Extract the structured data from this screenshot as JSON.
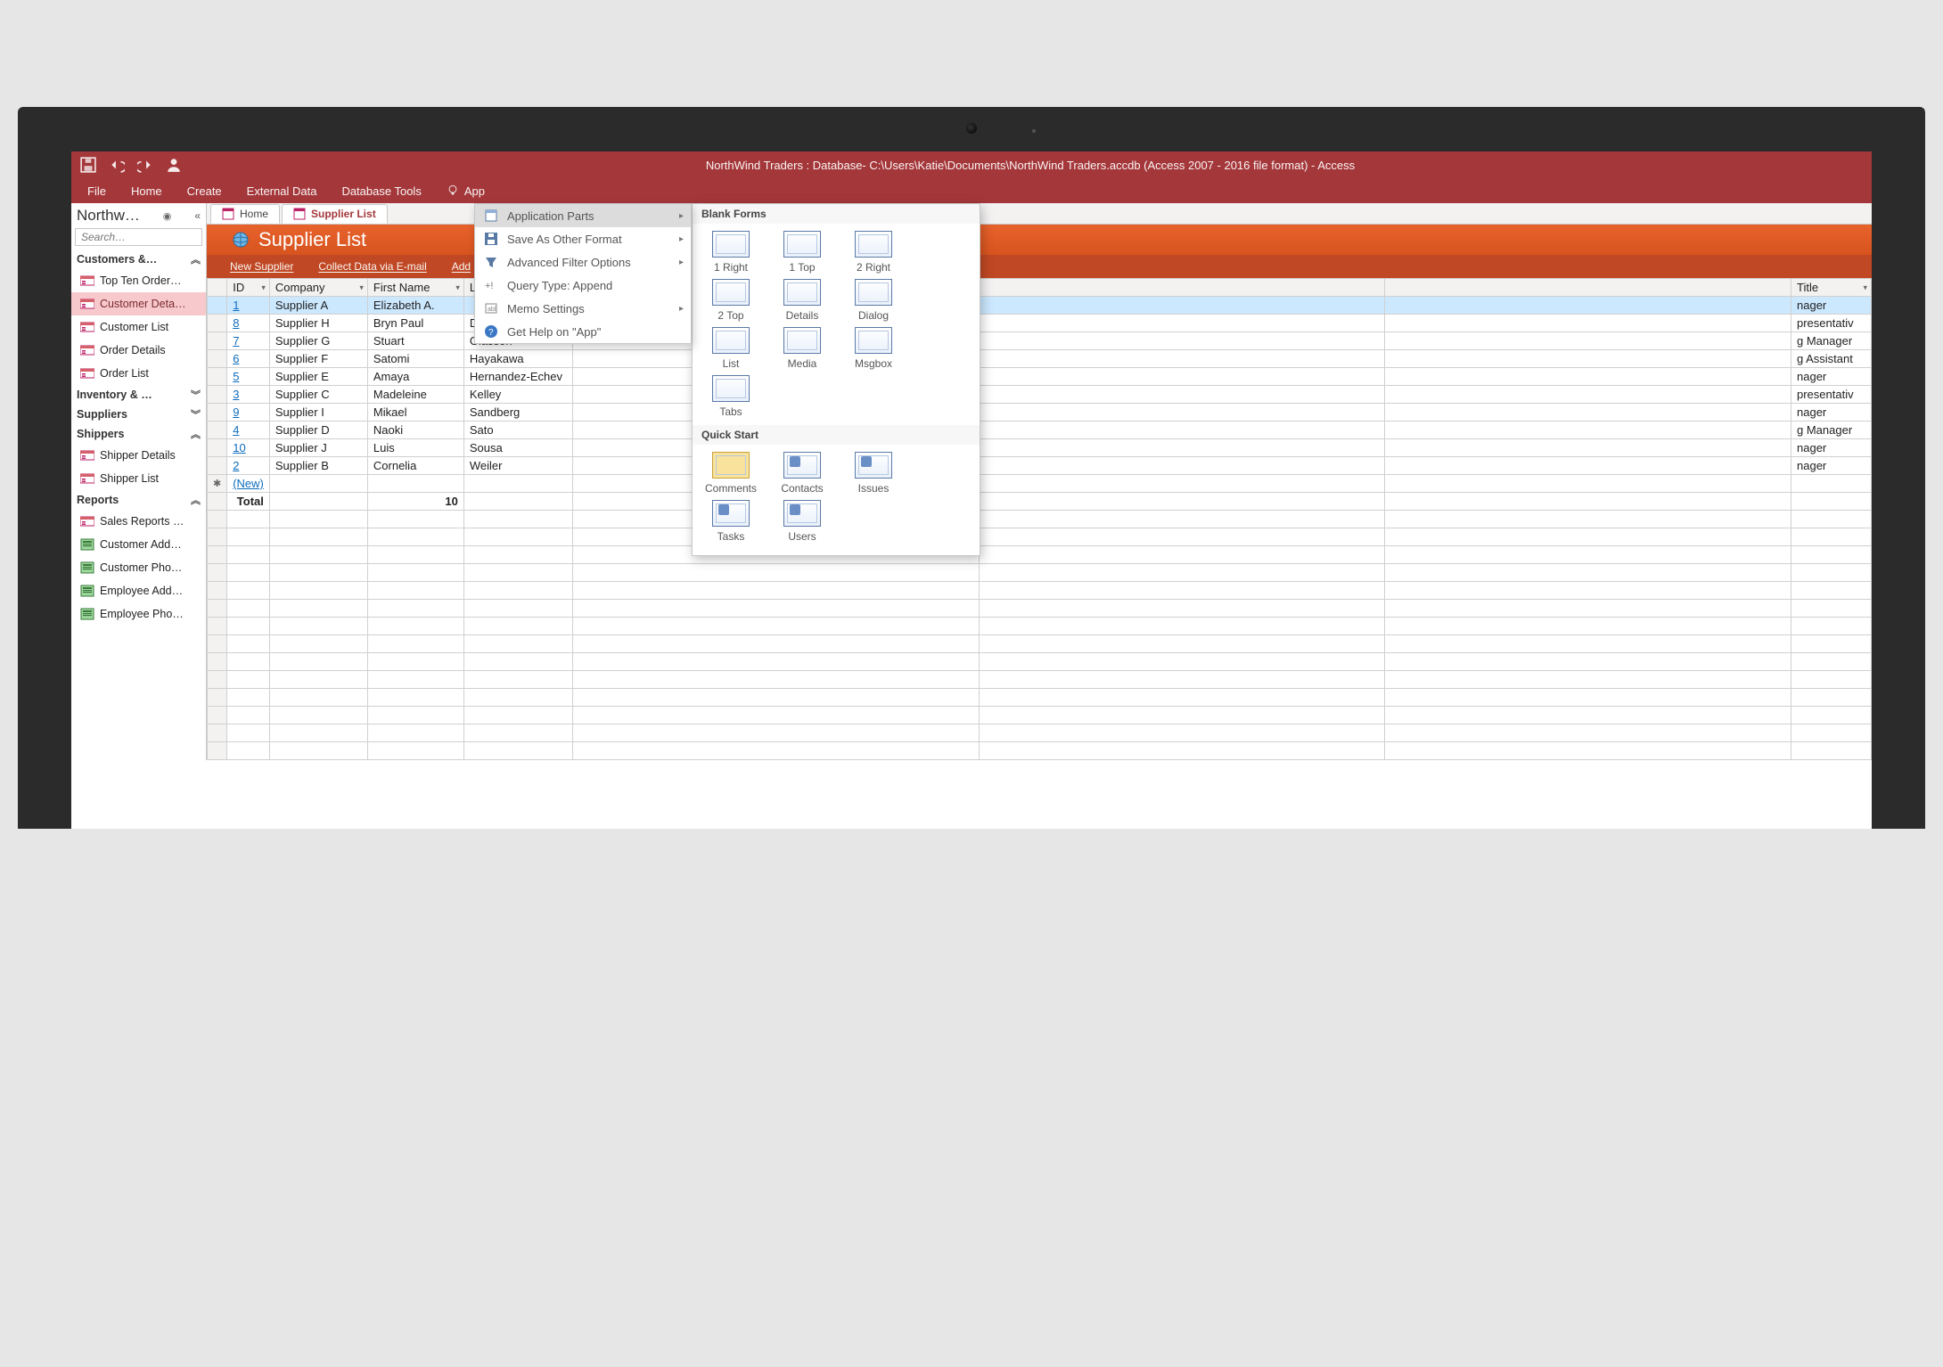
{
  "titlebar": {
    "title": "NorthWind Traders : Database- C:\\Users\\Katie\\Documents\\NorthWind Traders.accdb (Access 2007 - 2016 file format) - Access"
  },
  "ribbon": {
    "tabs": [
      "File",
      "Home",
      "Create",
      "External Data",
      "Database Tools"
    ],
    "app_tab": "App"
  },
  "navpane": {
    "title": "Northw…",
    "search_placeholder": "Search…",
    "groups": [
      {
        "label": "Customers &…",
        "expanded": true,
        "items": [
          {
            "label": "Top Ten Order…",
            "icon": "form"
          },
          {
            "label": "Customer Deta…",
            "icon": "form",
            "selected": true
          },
          {
            "label": "Customer List",
            "icon": "form"
          },
          {
            "label": "Order Details",
            "icon": "form"
          },
          {
            "label": "Order List",
            "icon": "form"
          }
        ]
      },
      {
        "label": "Inventory & …",
        "expanded": false,
        "items": []
      },
      {
        "label": "Suppliers",
        "expanded": false,
        "items": []
      },
      {
        "label": "Shippers",
        "expanded": true,
        "items": [
          {
            "label": "Shipper Details",
            "icon": "form"
          },
          {
            "label": "Shipper List",
            "icon": "form"
          }
        ]
      },
      {
        "label": "Reports",
        "expanded": true,
        "items": [
          {
            "label": "Sales Reports …",
            "icon": "form"
          },
          {
            "label": "Customer Add…",
            "icon": "report"
          },
          {
            "label": "Customer Pho…",
            "icon": "report"
          },
          {
            "label": "Employee Add…",
            "icon": "report"
          },
          {
            "label": "Employee Pho…",
            "icon": "report"
          }
        ]
      }
    ]
  },
  "doctabs": [
    {
      "label": "Home",
      "active": false
    },
    {
      "label": "Supplier List",
      "active": true
    }
  ],
  "form": {
    "title": "Supplier List",
    "toolbar": [
      "New Supplier",
      "Collect Data via E-mail",
      "Add"
    ]
  },
  "table": {
    "columns": [
      "",
      "ID",
      "Company",
      "First Name",
      "Last Name",
      "",
      "",
      "",
      "Title"
    ],
    "rows": [
      {
        "id": 1,
        "company": "Supplier A",
        "first": "Elizabeth A.",
        "last": "",
        "title": "nager",
        "selected": true
      },
      {
        "id": 8,
        "company": "Supplier H",
        "first": "Bryn Paul",
        "last": "Dunton",
        "title": "presentativ"
      },
      {
        "id": 7,
        "company": "Supplier G",
        "first": "Stuart",
        "last": "Glasson",
        "title": "g Manager"
      },
      {
        "id": 6,
        "company": "Supplier F",
        "first": "Satomi",
        "last": "Hayakawa",
        "title": "g Assistant"
      },
      {
        "id": 5,
        "company": "Supplier E",
        "first": "Amaya",
        "last": "Hernandez-Echev",
        "title": "nager"
      },
      {
        "id": 3,
        "company": "Supplier C",
        "first": "Madeleine",
        "last": "Kelley",
        "title": "presentativ"
      },
      {
        "id": 9,
        "company": "Supplier I",
        "first": "Mikael",
        "last": "Sandberg",
        "title": "nager"
      },
      {
        "id": 4,
        "company": "Supplier D",
        "first": "Naoki",
        "last": "Sato",
        "title": "g Manager"
      },
      {
        "id": 10,
        "company": "Supplier J",
        "first": "Luis",
        "last": "Sousa",
        "title": "nager"
      },
      {
        "id": 2,
        "company": "Supplier B",
        "first": "Cornelia",
        "last": "Weiler",
        "title": "nager"
      }
    ],
    "new_row_label": "(New)",
    "totals_label": "Total",
    "totals_value": "10"
  },
  "appmenu": {
    "items": [
      {
        "label": "Application Parts",
        "hover": true,
        "submenu": true,
        "icon": "parts"
      },
      {
        "label": "Save As Other Format",
        "submenu": true,
        "icon": "saveas"
      },
      {
        "label": "Advanced Filter Options",
        "submenu": true,
        "icon": "filter"
      },
      {
        "label": "Query Type: Append",
        "icon": "append"
      },
      {
        "label": "Memo Settings",
        "submenu": true,
        "icon": "memo"
      },
      {
        "label": "Get Help on \"App\"",
        "icon": "help"
      }
    ]
  },
  "gallery": {
    "sections": [
      {
        "title": "Blank Forms",
        "items": [
          "1 Right",
          "1 Top",
          "2 Right",
          "2 Top",
          "Details",
          "Dialog",
          "List",
          "Media",
          "Msgbox",
          "Tabs"
        ]
      },
      {
        "title": "Quick Start",
        "items": [
          "Comments",
          "Contacts",
          "Issues",
          "Tasks",
          "Users"
        ]
      }
    ]
  }
}
